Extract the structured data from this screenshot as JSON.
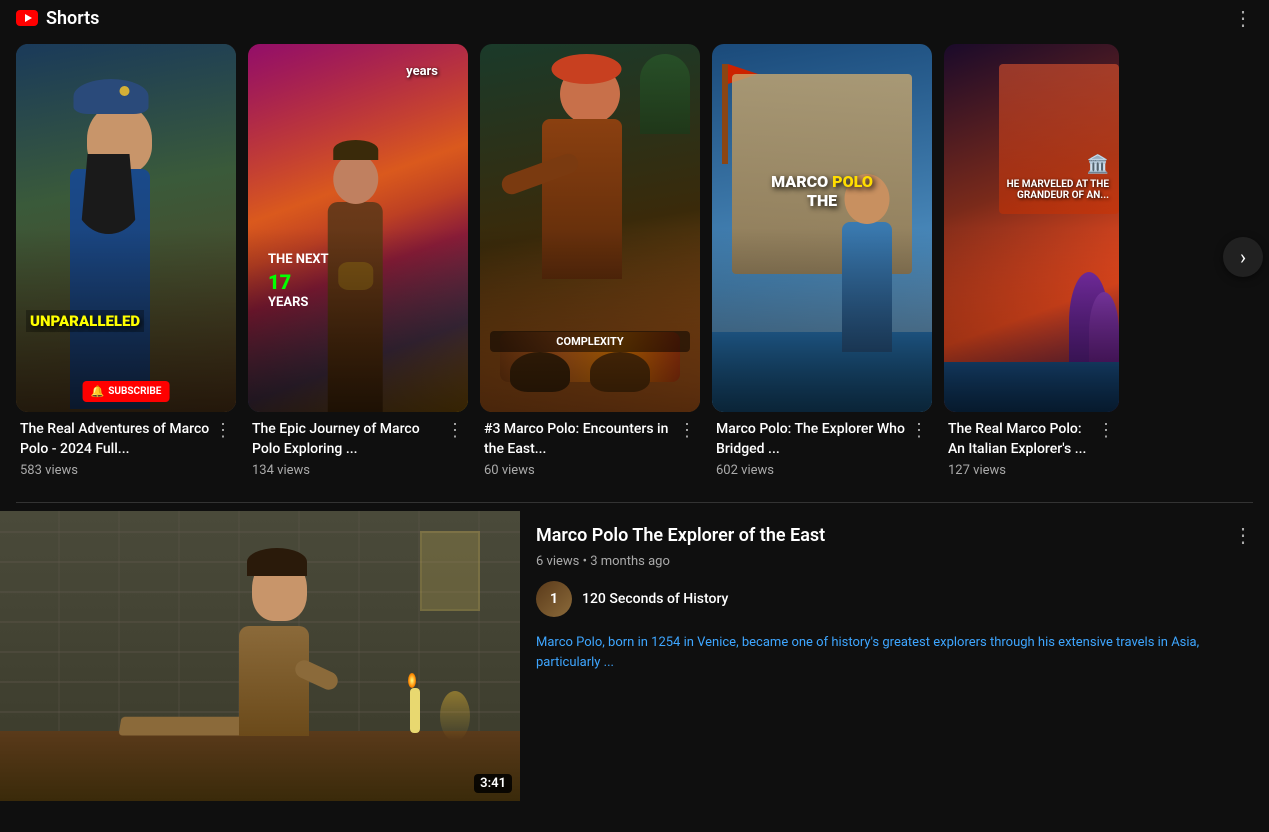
{
  "header": {
    "title": "Shorts",
    "logo_color": "#ff0000"
  },
  "shorts": {
    "cards": [
      {
        "id": "short-1",
        "title": "The Real Adventures of Marco Polo - 2024 Full...",
        "views": "583 views",
        "overlay": "UNPARALLELED",
        "overlay_type": "yellow"
      },
      {
        "id": "short-2",
        "title": "The Epic Journey of Marco Polo  Exploring ...",
        "views": "134 views",
        "overlay_line1": "THE NEXT",
        "overlay_num": "17",
        "overlay_line2": "YEARS"
      },
      {
        "id": "short-3",
        "title": "#3 Marco Polo: Encounters in the East...",
        "views": "60 views",
        "overlay": "COMPLEXITY"
      },
      {
        "id": "short-4",
        "title": "Marco Polo: The Explorer Who Bridged ...",
        "views": "602 views",
        "overlay_line1": "MARCO POLO",
        "overlay_line2": "THE"
      },
      {
        "id": "short-5",
        "title": "The Real Marco Polo: An Italian Explorer's ...",
        "views": "127 views",
        "overlay": "HE MARVELED AT THE GRANDEUR OF AN..."
      }
    ],
    "next_button": "›"
  },
  "featured_video": {
    "title": "Marco Polo The Explorer of the East",
    "views": "6 views",
    "time_ago": "3 months ago",
    "meta": "6 views • 3 months ago",
    "channel": {
      "name": "120 Seconds of History",
      "avatar_letter": "1"
    },
    "description": "Marco Polo, born in 1254 in Venice, became one of history's greatest explorers through his extensive travels in Asia, particularly ...",
    "description_highlight": "Marco Polo",
    "timestamp": "3:41",
    "dots_label": "⋮"
  }
}
